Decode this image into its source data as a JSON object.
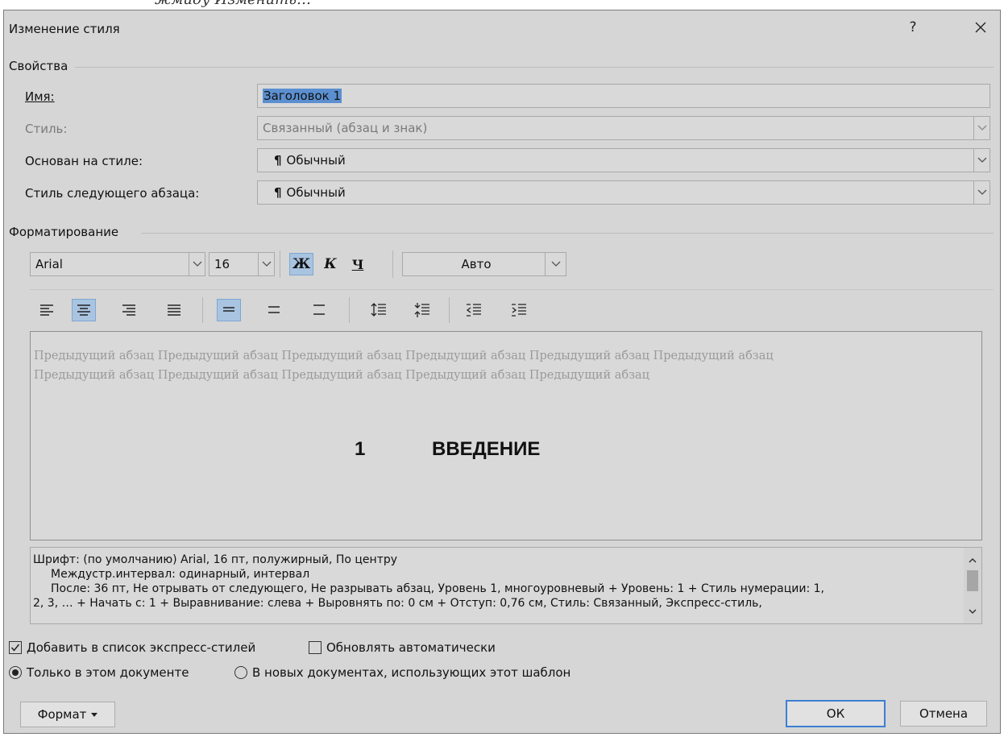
{
  "backdrop_text": "жмиду Изменить…",
  "dialog": {
    "title": "Изменение стиля",
    "help": "?",
    "close": "✕"
  },
  "properties": {
    "group_title": "Свойства",
    "name_label": "Имя:",
    "name_value": "Заголовок 1",
    "style_type_label": "Стиль:",
    "style_type_value": "Связанный (абзац и знак)",
    "based_on_label": "Основан на стиле:",
    "based_on_value": "Обычный",
    "next_style_label": "Стиль следующего абзаца:",
    "next_style_value": "Обычный",
    "pilcrow": "¶"
  },
  "formatting": {
    "group_title": "Форматирование",
    "font": "Arial",
    "size": "16",
    "bold": "Ж",
    "italic": "К",
    "underline": "Ч",
    "color": "Авто",
    "bold_pressed": true,
    "align_center_pressed": true,
    "spacing_single_pressed": true
  },
  "preview": {
    "previous_paragraph": "Предыдущий абзац Предыдущий абзац Предыдущий абзац Предыдущий абзац Предыдущий абзац Предыдущий абзац Предыдущий абзац Предыдущий абзац Предыдущий абзац Предыдущий абзац Предыдущий абзац",
    "heading_number": "1",
    "heading_text": "ВВЕДЕНИЕ"
  },
  "description": {
    "line1": "Шрифт: (по умолчанию) Arial, 16 пт, полужирный, По центру",
    "line2": "Междустр.интервал:  одинарный, интервал",
    "line3": "После:  36 пт, Не отрывать от следующего, Не разрывать абзац, Уровень 1, многоуровневый + Уровень: 1 + Стиль нумерации: 1,",
    "line4": "2, 3, … + Начать с: 1 + Выравнивание: слева + Выровнять по:  0 см + Отступ:  0,76 см, Стиль: Связанный, Экспресс-стиль,"
  },
  "options": {
    "add_quick_styles": "Добавить в список экспресс-стилей",
    "add_quick_styles_checked": true,
    "auto_update": "Обновлять автоматически",
    "auto_update_checked": false,
    "only_this_doc": "Только в этом документе",
    "only_this_doc_selected": true,
    "new_docs": "В новых документах, использующих этот шаблон",
    "new_docs_selected": false
  },
  "buttons": {
    "format": "Формат",
    "ok": "ОК",
    "cancel": "Отмена"
  },
  "colors": {
    "dialog_bg": "#d6d6d6",
    "selection": "#5b8fd0",
    "pressed": "#a9c4e0",
    "default_border": "#3c7fd3"
  }
}
